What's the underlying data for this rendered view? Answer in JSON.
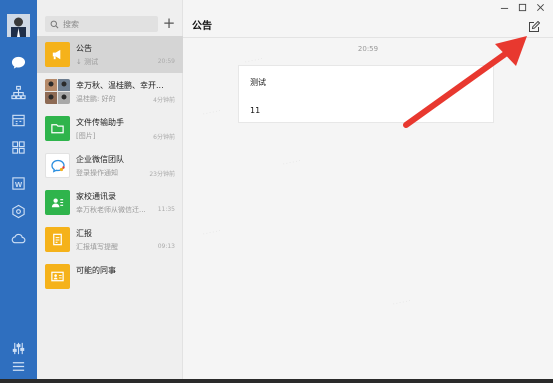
{
  "sidebar": {
    "icons": [
      "chat-icon",
      "org-chart-icon",
      "calendar-icon",
      "apps-grid-icon",
      "word-doc-icon",
      "hexagon-icon",
      "cloud-icon",
      "settings-sliders-icon",
      "menu-icon"
    ]
  },
  "list": {
    "search_placeholder": "搜索",
    "items": [
      {
        "title": "公告",
        "subtitle": "↓ 测试",
        "time": "20:59",
        "icon": "megaphone-icon",
        "color": "#f5b21a"
      },
      {
        "title": "幸万秋、温桂鹏、幸开...",
        "subtitle": "温桂鹏: 好的",
        "time": "4分钟前",
        "icon": "group-avatar-icon",
        "color": "#d9d9d9"
      },
      {
        "title": "文件传输助手",
        "subtitle": "[图片]",
        "time": "6分钟前",
        "icon": "folder-icon",
        "color": "#2fb44c"
      },
      {
        "title": "企业微信团队",
        "subtitle": "登录操作通知",
        "time": "23分钟前",
        "icon": "wecom-logo-icon",
        "color": "#ffffff"
      },
      {
        "title": "家校通讯录",
        "subtitle": "幸万秋老师从微信迁...",
        "time": "11:35",
        "icon": "contacts-icon",
        "color": "#2fb44c"
      },
      {
        "title": "汇报",
        "subtitle": "汇报填写提醒",
        "time": "09:13",
        "icon": "report-icon",
        "color": "#f5b21a"
      },
      {
        "title": "可能的同事",
        "subtitle": "",
        "time": "",
        "icon": "id-card-icon",
        "color": "#f5b21a"
      }
    ]
  },
  "main": {
    "title": "公告",
    "timestamp": "20:59",
    "card_title": "测试",
    "card_body": "11"
  },
  "colors": {
    "rail": "#2f6fbf",
    "arrow": "#e8382f",
    "selected_row": "#d5d5d5"
  }
}
